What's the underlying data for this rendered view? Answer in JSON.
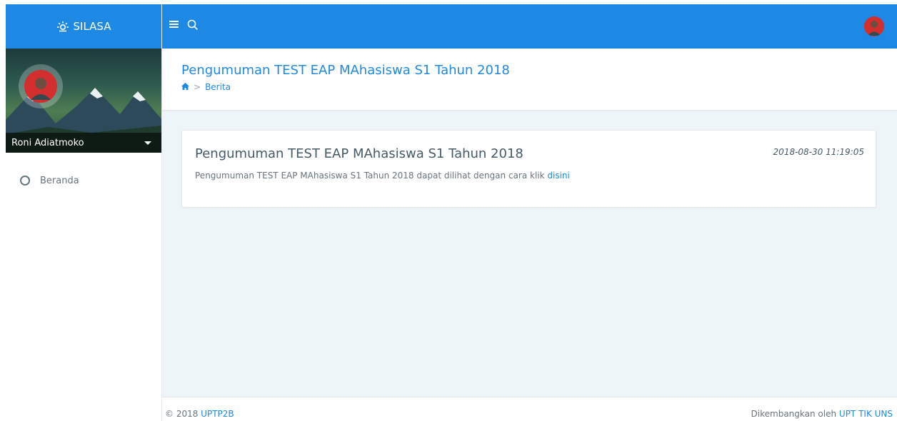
{
  "brand": {
    "name": "SILASA",
    "icon": "sun-icon"
  },
  "colors": {
    "primary": "#1e88e5",
    "text": "#67757c",
    "heading": "#455a64",
    "content_bg": "#eef5f9"
  },
  "sidebar": {
    "user_name": "Roni Adiatmoko",
    "menu": [
      {
        "label": "Beranda",
        "icon": "circle-icon"
      }
    ]
  },
  "topbar": {
    "menu_icon": "hamburger-icon",
    "search_icon": "search-icon",
    "avatar": "user-avatar"
  },
  "page": {
    "title": "Pengumuman TEST EAP MAhasiswa S1 Tahun 2018",
    "breadcrumb": {
      "home_icon": "home-icon",
      "current": "Berita"
    }
  },
  "post": {
    "title": "Pengumuman TEST EAP MAhasiswa S1 Tahun 2018",
    "date": "2018-08-30 11:19:05",
    "text": "Pengumuman TEST EAP MAhasiswa S1 Tahun 2018 dapat dilihat dengan cara klik ",
    "link_label": "disini"
  },
  "footer": {
    "copyright": "© 2018 ",
    "copyright_link": "UPTP2B",
    "developed_by": "Dikembangkan oleh ",
    "developer_link": "UPT TIK UNS"
  }
}
